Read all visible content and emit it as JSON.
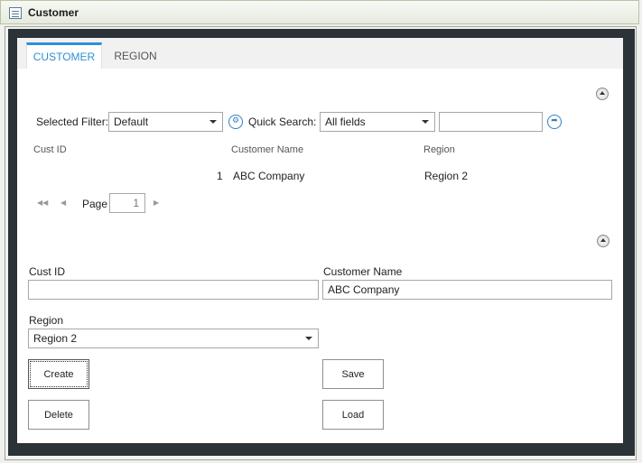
{
  "window": {
    "title": "Customer",
    "icon": "list-window-icon"
  },
  "tabs": [
    {
      "label": "CUSTOMER",
      "active": true
    },
    {
      "label": "REGION",
      "active": false
    }
  ],
  "filter_bar": {
    "selected_filter_label": "Selected Filter:",
    "selected_filter_value": "Default",
    "quick_search_label": "Quick Search:",
    "quick_search_field": "All fields",
    "quick_search_text": ""
  },
  "grid": {
    "columns": [
      "Cust ID",
      "Customer Name",
      "Region"
    ],
    "rows": [
      {
        "cust_id": "1",
        "customer_name": "ABC Company",
        "region": "Region 2"
      }
    ]
  },
  "pager": {
    "page_label": "Page",
    "page_value": "1"
  },
  "form": {
    "cust_id_label": "Cust ID",
    "cust_id_value": "",
    "customer_name_label": "Customer Name",
    "customer_name_value": "ABC Company",
    "region_label": "Region",
    "region_value": "Region 2"
  },
  "buttons": {
    "create": "Create",
    "save": "Save",
    "delete": "Delete",
    "load": "Load"
  },
  "colors": {
    "accent": "#2f8fd6",
    "frame": "#2b3238"
  }
}
